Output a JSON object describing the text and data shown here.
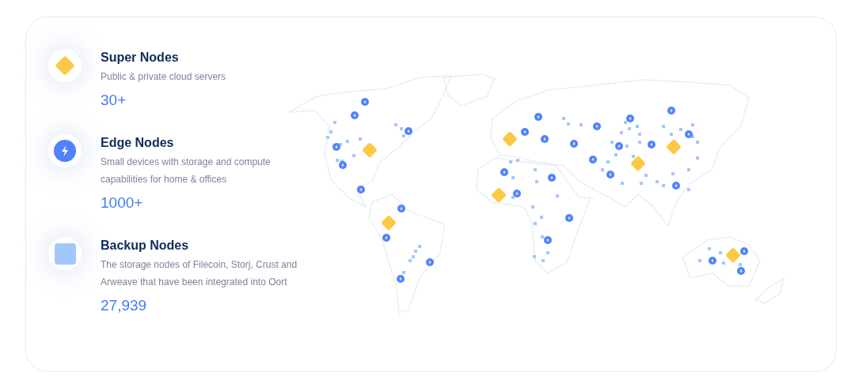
{
  "nodes": [
    {
      "kind": "super",
      "title": "Super Nodes",
      "description": "Public & private cloud servers",
      "count": "30+"
    },
    {
      "kind": "edge",
      "title": "Edge Nodes",
      "description": "Small devices with storage and compute capabilities for home & offices",
      "count": "1000+"
    },
    {
      "kind": "backup",
      "title": "Backup Nodes",
      "description": "The storage nodes of Filecoin, Storj, Crust and Arweave that have been integrated into Oort",
      "count": "27,939"
    }
  ]
}
